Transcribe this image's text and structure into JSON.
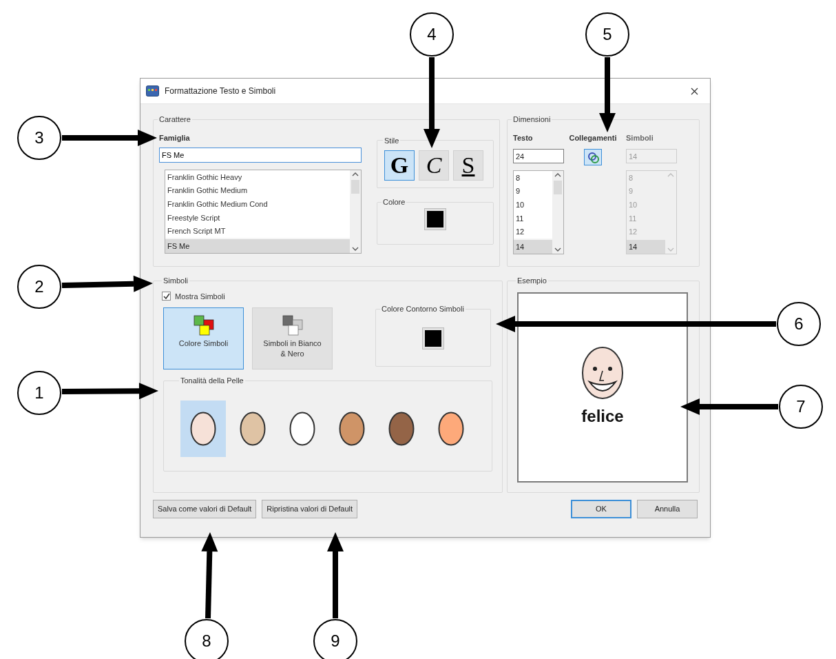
{
  "dialog": {
    "title": "Formattazione Testo e Simboli",
    "carattere": {
      "label": "Carattere",
      "famiglia_label": "Famiglia",
      "famiglia_value": "FS Me",
      "fonts": [
        {
          "name": "Franklin Gothic Heavy",
          "selected": false
        },
        {
          "name": "Franklin Gothic Medium",
          "selected": false
        },
        {
          "name": "Franklin Gothic Medium Cond",
          "selected": false
        },
        {
          "name": "Freestyle Script",
          "selected": false
        },
        {
          "name": "French Script MT",
          "selected": false
        },
        {
          "name": "FS Me",
          "selected": true
        }
      ]
    },
    "stile": {
      "label": "Stile",
      "buttons": [
        {
          "label": "G",
          "kind": "bold",
          "selected": true
        },
        {
          "label": "C",
          "kind": "italic",
          "selected": false
        },
        {
          "label": "S",
          "kind": "underline",
          "selected": false
        }
      ]
    },
    "colore": {
      "label": "Colore",
      "color": "#000000"
    },
    "dimensioni": {
      "label": "Dimensioni",
      "testo": {
        "label": "Testo",
        "value": "24",
        "disabled": false,
        "sizes": [
          {
            "value": "8",
            "selected": false
          },
          {
            "value": "9",
            "selected": false
          },
          {
            "value": "10",
            "selected": false
          },
          {
            "value": "11",
            "selected": false
          },
          {
            "value": "12",
            "selected": false
          },
          {
            "value": "14",
            "selected": true
          }
        ]
      },
      "collegamenti": {
        "label": "Collegamenti",
        "linked": true
      },
      "simboli": {
        "label": "Simboli",
        "value": "14",
        "disabled": true,
        "sizes": [
          {
            "value": "8",
            "selected": false
          },
          {
            "value": "9",
            "selected": false
          },
          {
            "value": "10",
            "selected": false
          },
          {
            "value": "11",
            "selected": false
          },
          {
            "value": "12",
            "selected": false
          },
          {
            "value": "14",
            "selected": true
          }
        ]
      }
    },
    "simboli": {
      "label": "Simboli",
      "show": {
        "label": "Mostra Simboli",
        "checked": true
      },
      "modes": [
        {
          "label": "Colore Simboli",
          "kind": "color",
          "selected": true
        },
        {
          "label": "Simboli in Bianco & Nero",
          "kind": "bw",
          "selected": false
        }
      ],
      "outline": {
        "label": "Colore Contorno Simboli",
        "color": "#000000"
      },
      "skin": {
        "label": "Tonalità della Pelle",
        "tones": [
          {
            "color": "#f6e1d8",
            "selected": true
          },
          {
            "color": "#dfc3a4",
            "selected": false
          },
          {
            "color": "#ffffff",
            "selected": false
          },
          {
            "color": "#cf9467",
            "selected": false
          },
          {
            "color": "#946447",
            "selected": false
          },
          {
            "color": "#fda97a",
            "selected": false
          }
        ]
      }
    },
    "esempio": {
      "label": "Esempio",
      "word": "felice"
    },
    "buttons": [
      {
        "label": "Salva come valori di Default",
        "default": false
      },
      {
        "label": "Ripristina valori di Default",
        "default": false
      },
      {
        "label": "OK",
        "default": true
      },
      {
        "label": "Annulla",
        "default": false
      }
    ]
  },
  "callouts": [
    {
      "label": "4"
    },
    {
      "label": "5"
    },
    {
      "label": "3"
    },
    {
      "label": "2"
    },
    {
      "label": "6"
    },
    {
      "label": "1"
    },
    {
      "label": "7"
    },
    {
      "label": "8"
    },
    {
      "label": "9"
    }
  ]
}
